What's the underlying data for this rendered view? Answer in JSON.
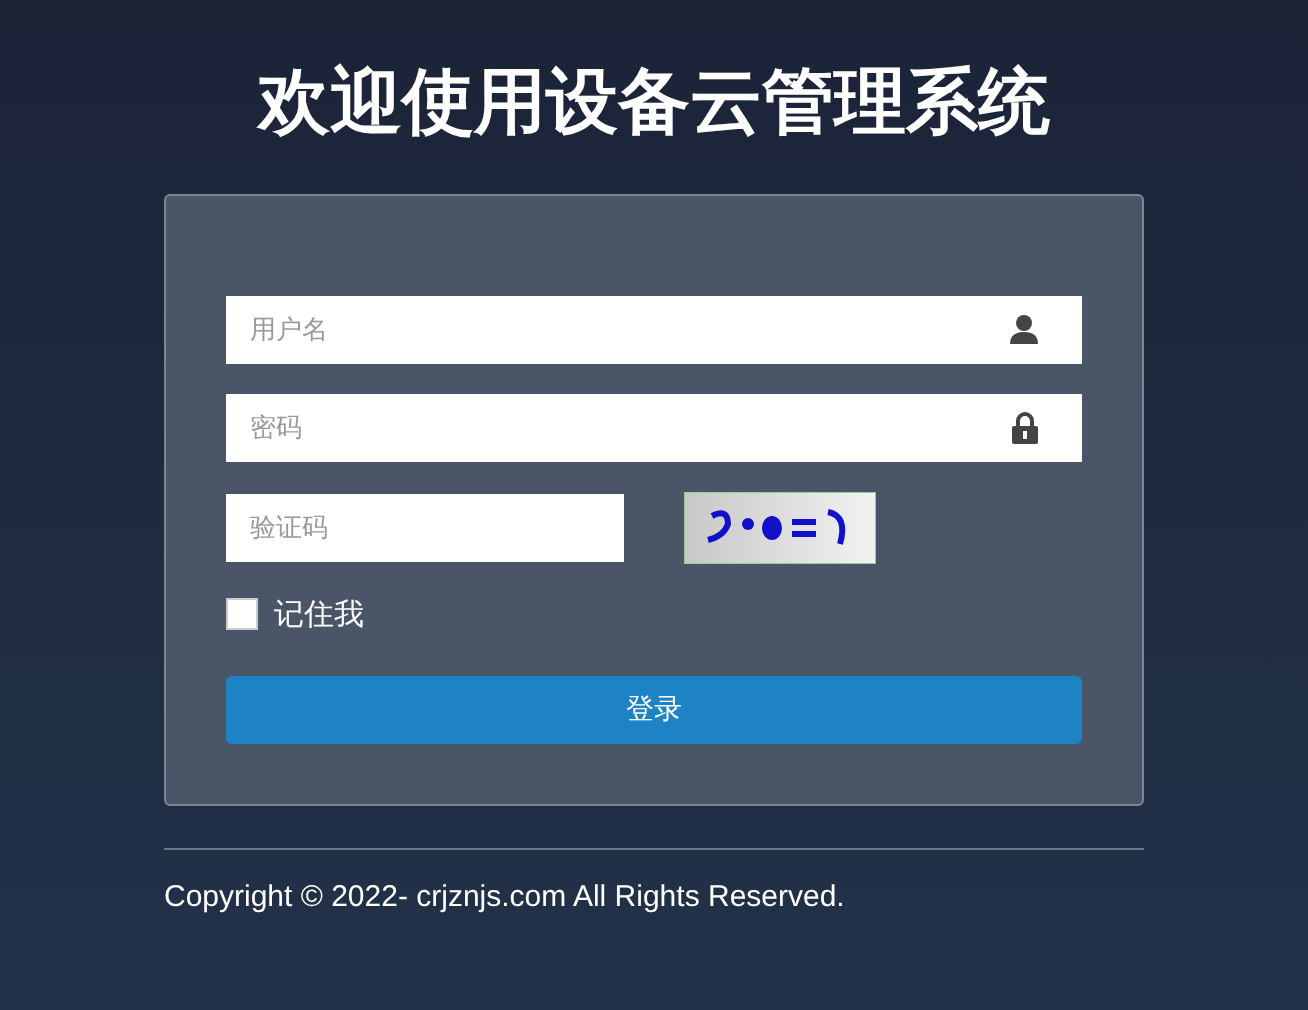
{
  "title": "欢迎使用设备云管理系统",
  "form": {
    "username": {
      "placeholder": "用户名"
    },
    "password": {
      "placeholder": "密码"
    },
    "captcha": {
      "placeholder": "验证码"
    },
    "remember": {
      "label": "记住我",
      "checked": false
    },
    "submit": "登录"
  },
  "footer": "Copyright © 2022- crjznjs.com All Rights Reserved."
}
